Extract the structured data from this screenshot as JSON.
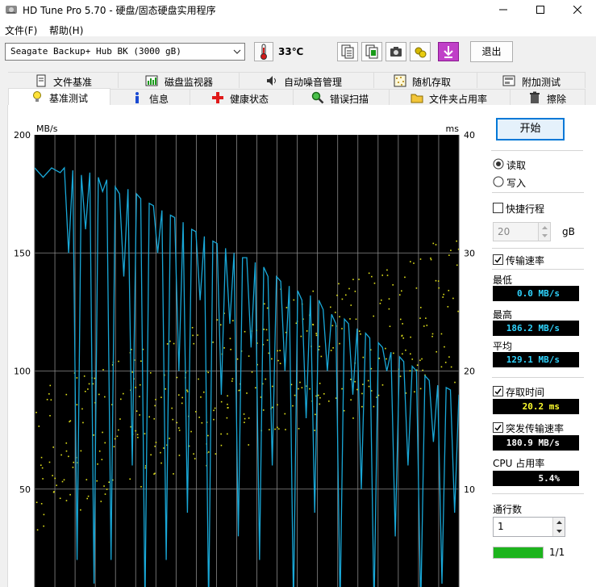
{
  "window": {
    "title": "HD Tune Pro 5.70 - 硬盘/固态硬盘实用程序"
  },
  "menu": [
    {
      "label": "文件(F)"
    },
    {
      "label": "帮助(H)"
    }
  ],
  "toolbar": {
    "drive": "Seagate Backup+ Hub BK (3000 gB)",
    "temperature": "33℃",
    "exit_label": "退出"
  },
  "tabs_top": [
    {
      "label": "文件基准",
      "icon": "document-icon"
    },
    {
      "label": "磁盘监视器",
      "icon": "monitor-chart-icon"
    },
    {
      "label": "自动噪音管理",
      "icon": "speaker-icon"
    },
    {
      "label": "随机存取",
      "icon": "random-dots-icon"
    },
    {
      "label": "附加测试",
      "icon": "extra-test-icon"
    }
  ],
  "tabs_bottom": [
    {
      "label": "基准测试",
      "icon": "bulb-icon",
      "active": true
    },
    {
      "label": "信息",
      "icon": "info-icon"
    },
    {
      "label": "健康状态",
      "icon": "red-cross-icon"
    },
    {
      "label": "错误扫描",
      "icon": "magnifier-icon"
    },
    {
      "label": "文件夹占用率",
      "icon": "folder-icon"
    },
    {
      "label": "擦除",
      "icon": "trash-icon"
    }
  ],
  "panel": {
    "start_label": "开始",
    "read_label": "读取",
    "write_label": "写入",
    "mode_selected": "read",
    "quick_label": "快捷行程",
    "quick_checked": false,
    "quick_value": "20",
    "quick_unit": "gB",
    "transfer_label": "传输速率",
    "transfer_checked": true,
    "min_label": "最低",
    "min_value": "0.0 MB/s",
    "max_label": "最高",
    "max_value": "186.2 MB/s",
    "avg_label": "平均",
    "avg_value": "129.1 MB/s",
    "access_label": "存取时间",
    "access_checked": true,
    "access_value": "20.2 ms",
    "burst_label": "突发传输速率",
    "burst_checked": true,
    "burst_value": "180.9 MB/s",
    "cpu_label": "CPU 占用率",
    "cpu_value": "5.4%",
    "threads_label": "通行数",
    "threads_value": "1",
    "progress_text": "1/1",
    "progress_fraction": 1.0
  },
  "colors": {
    "line": "#19a8d8",
    "dots": "#e2e21a",
    "plot_bg": "#000000",
    "grid": "#8a8a8a",
    "progress": "#1db41d"
  },
  "chart_data": {
    "type": "line",
    "y_left_label": "MB/s",
    "y_right_label": "ms",
    "y_left_ticks": [
      "200",
      "150",
      "100",
      "50"
    ],
    "y_right_ticks": [
      "40",
      "30",
      "20",
      "10"
    ],
    "ylim_left": [
      0,
      200
    ],
    "ylim_right": [
      0,
      40
    ],
    "grid": true,
    "series": [
      {
        "unit": "MB/s",
        "x": [
          0,
          2,
          4,
          5,
          6,
          7,
          8,
          9,
          10,
          11,
          12,
          13,
          14,
          15,
          16,
          17,
          18,
          19,
          20,
          21,
          22,
          23,
          24,
          25,
          26,
          27,
          28,
          29,
          30,
          31,
          32,
          33,
          34,
          35,
          36,
          37,
          38,
          39,
          40,
          41,
          42,
          43,
          44,
          45,
          46,
          47,
          48,
          49,
          50,
          51,
          52,
          53,
          54,
          55,
          56,
          57,
          58,
          59,
          60,
          61,
          62,
          63,
          64,
          65,
          66,
          67,
          68,
          69,
          70,
          71,
          72,
          73,
          74,
          75,
          76,
          77,
          78,
          79,
          80,
          81,
          82,
          83,
          84,
          85,
          86,
          87,
          88,
          89,
          90,
          91,
          92,
          93,
          94,
          95,
          96,
          97,
          98,
          99,
          100
        ],
        "values": [
          186,
          182,
          186,
          185,
          184,
          186,
          150,
          185,
          20,
          183,
          160,
          184,
          10,
          182,
          176,
          181,
          20,
          178,
          175,
          140,
          177,
          60,
          175,
          173,
          0,
          171,
          170,
          150,
          168,
          20,
          166,
          165,
          100,
          163,
          40,
          160,
          159,
          130,
          157,
          0,
          155,
          154,
          90,
          152,
          120,
          150,
          30,
          148,
          148,
          110,
          146,
          20,
          144,
          140,
          60,
          140,
          138,
          100,
          136,
          0,
          134,
          130,
          80,
          132,
          40,
          130,
          126,
          100,
          124,
          120,
          0,
          122,
          120,
          90,
          118,
          50,
          116,
          114,
          0,
          112,
          110,
          100,
          108,
          30,
          106,
          104,
          60,
          102,
          100,
          0,
          98,
          96,
          70,
          94,
          10,
          93,
          92,
          40,
          90
        ]
      },
      {
        "unit": "ms",
        "type": "scatter",
        "note": "access time samples",
        "x": [
          0,
          3,
          6,
          9,
          12,
          15,
          18,
          21,
          24,
          27,
          30,
          33,
          36,
          39,
          42,
          45,
          48,
          51,
          54,
          57,
          60,
          63,
          66,
          69,
          72,
          75,
          78,
          81,
          84,
          87,
          90,
          93,
          96,
          99
        ],
        "values": [
          12,
          13,
          14,
          14,
          15,
          15,
          16,
          16,
          16,
          17,
          17,
          17,
          18,
          18,
          19,
          19,
          19,
          20,
          20,
          21,
          21,
          21,
          22,
          22,
          22,
          23,
          23,
          23,
          24,
          24,
          24,
          25,
          25,
          26
        ]
      }
    ]
  }
}
